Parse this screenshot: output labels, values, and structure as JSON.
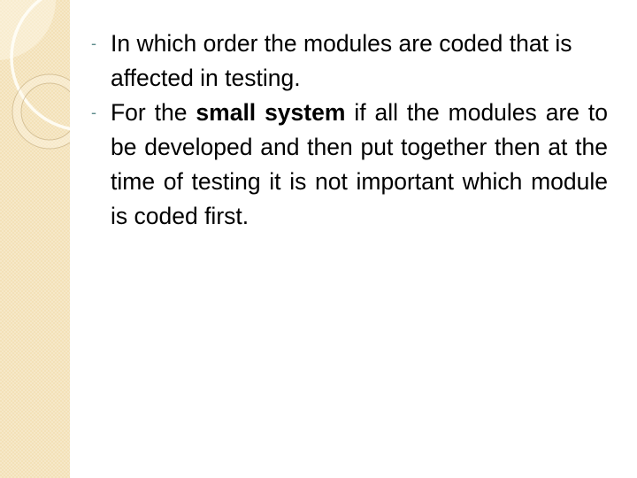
{
  "slide": {
    "bullets": [
      {
        "marker": "-",
        "text_before": "In which order the modules are coded that is affected in testing.",
        "bold": "",
        "text_after": ""
      },
      {
        "marker": "-",
        "text_before": "For the ",
        "bold": "small system",
        "text_after": " if all the modules are to be developed and then put together then at the time of testing it is not important which module is coded first."
      }
    ]
  },
  "colors": {
    "sidebar_background": "#f3e1b8",
    "bullet_marker": "#5e8c8c",
    "text": "#000000"
  }
}
